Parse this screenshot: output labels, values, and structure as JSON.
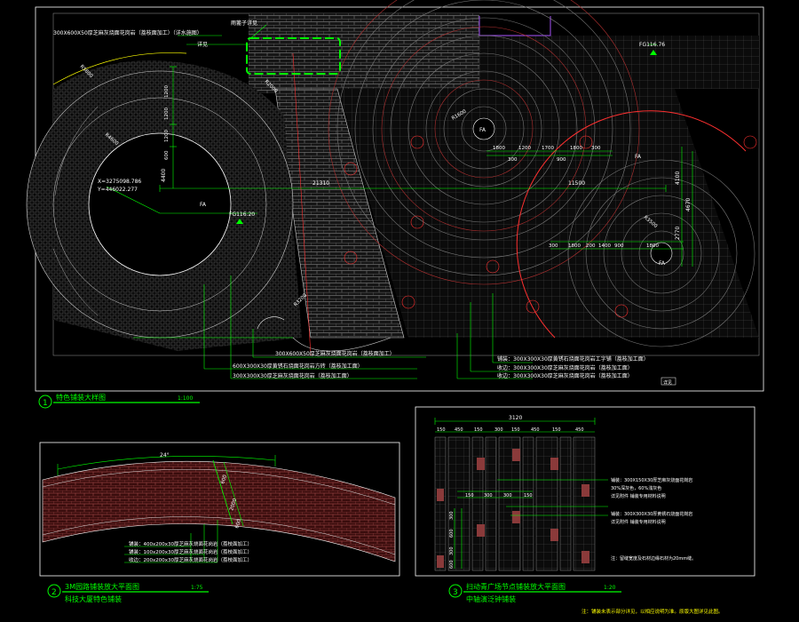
{
  "colors": {
    "background": "#000000",
    "frame": "#ffffff",
    "dimension": "#00ff00",
    "annotation": "#ffffff",
    "title": "#00ff00",
    "accent_red": "#ff3030",
    "highlight": "#ffff00",
    "brick": "#8a2a2a"
  },
  "plan1": {
    "number": "1",
    "title": "特色铺装大样图",
    "scale": "1:100",
    "top_note": "300X600X50厚芝麻灰烧面花岗岩（荔枝面加工）（详水施图）",
    "corner_note": "雨篦子详见",
    "corner_note2": "详见",
    "mark_fa_1": "FA",
    "mark_fa_2": "FA",
    "mark_fa_3": "FA",
    "mark_fa_4": "FA",
    "level_1": "FG116.76",
    "level_2": "FG116.20",
    "dim_long_1": "21310",
    "dim_long_2": "11500",
    "dim_v_1": "4400",
    "dim_v_2": "4100",
    "dim_v_3": "4670",
    "dim_v_4": "2770",
    "dims_top": [
      "1800",
      "1200",
      "1700",
      "1800",
      "300"
    ],
    "dims_top2": [
      "300",
      "900"
    ],
    "dims_bottom": [
      "300",
      "1800",
      "200",
      "1400",
      "900",
      "1800"
    ],
    "dims_left": [
      "1200",
      "1200",
      "1200",
      "600"
    ],
    "coord_x": "X=3275098.786",
    "coord_y": "Y=446022.277",
    "radius_labels": [
      "R5800",
      "R4600",
      "R1600",
      "R3500",
      "R2000",
      "R3200"
    ],
    "callouts_left": [
      "300X600X50厚芝麻灰烧面花岗岩（荔枝面加工）",
      "600X300X30厚黄锈石烧面花岗岩方砖（荔枝加工面）",
      "300X300X30厚芝麻灰烧面花岗岩（荔枝加工面）"
    ],
    "callouts_right": [
      "铺装：300X300X30厚黄锈石烧面花岗岩工字铺（荔枝加工面）",
      "收边：300X300X30厚芝麻灰烧面花岗岩（荔枝加工面）",
      "收边：300X300X30厚芝麻灰烧面花岗岩（荔枝加工面）"
    ],
    "callout_tag": "详见"
  },
  "plan2": {
    "number": "2",
    "title": "3M园路铺装放大平面图",
    "subtitle": "科技大厦特色铺装",
    "scale": "1:75",
    "angle": "24°",
    "dims": [
      "600",
      "2000",
      "600"
    ],
    "notes": [
      "铺装：400x200x30厚芝麻灰烧面花岗岩（荔枝面加工）",
      "铺装：100x200x30厚芝麻灰烧面花岗岩（荔枝面加工）",
      "收边：200x200x30厚芝麻灰烧面花岗岩（荔枝面加工）"
    ]
  },
  "plan3": {
    "number": "3",
    "title": "扫动青广场节点铺装放大平面图",
    "subtitle": "中轴演泛钟铺装",
    "scale": "1:20",
    "dim_total": "3120",
    "dims_top": [
      "150",
      "450",
      "150",
      "300",
      "150",
      "450",
      "150",
      "450"
    ],
    "dims_mid": [
      "150",
      "300",
      "300",
      "150"
    ],
    "dims_left": [
      "300",
      "600",
      "300",
      "600"
    ],
    "notes": [
      "铺装：300X150X30厚芝麻灰烧面花岗岩",
      "30%深灰色，60%浅灰色",
      "详见附件 铺装专用材料说明",
      "铺装：300X300X30厚黄锈石烧面花岗岩",
      "详见附件 铺装专用材料说明"
    ],
    "footnote": "注：留缝宽度及石材边缘石材为20mm缝。"
  },
  "sheet_note": "注：铺装未表示部分详见，以相应说明为准。原版大图详见此图。"
}
